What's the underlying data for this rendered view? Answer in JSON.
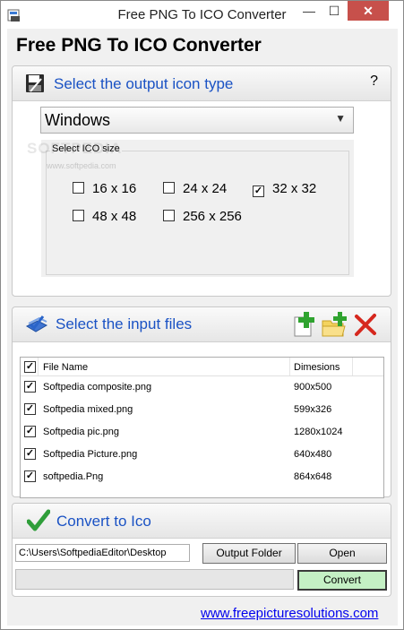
{
  "window": {
    "title": "Free PNG To ICO Converter",
    "minimize": "—",
    "maximize": "☐",
    "close": "✕"
  },
  "app": {
    "heading": "Free PNG To ICO Converter"
  },
  "output_panel": {
    "title": "Select the output icon type",
    "help": "?",
    "icon_type_selected": "Windows",
    "size_group_label": "Select ICO size",
    "sizes": [
      {
        "label": "16 x 16",
        "checked": false
      },
      {
        "label": "24 x 24",
        "checked": false
      },
      {
        "label": "32 x 32",
        "checked": true
      },
      {
        "label": "48 x 48",
        "checked": false
      },
      {
        "label": "256 x 256",
        "checked": false
      }
    ],
    "watermark": "SOFTPEDIA",
    "watermark_url": "www.softpedia.com"
  },
  "input_panel": {
    "title": "Select the input files",
    "icons": [
      "add-file-icon",
      "add-folder-icon",
      "remove-icon"
    ],
    "columns": {
      "name": "File Name",
      "dimensions": "Dimesions"
    },
    "files": [
      {
        "name": "Softpedia composite.png",
        "dimensions": "900x500",
        "checked": true
      },
      {
        "name": "Softpedia mixed.png",
        "dimensions": "599x326",
        "checked": true
      },
      {
        "name": "Softpedia pic.png",
        "dimensions": "1280x1024",
        "checked": true
      },
      {
        "name": "Softpedia Picture.png",
        "dimensions": "640x480",
        "checked": true
      },
      {
        "name": "softpedia.Png",
        "dimensions": "864x648",
        "checked": true
      }
    ]
  },
  "convert_panel": {
    "title": "Convert to Ico",
    "output_path": "C:\\Users\\SoftpediaEditor\\Desktop",
    "output_folder_label": "Output Folder",
    "open_label": "Open",
    "convert_label": "Convert",
    "progress": 0
  },
  "footer": {
    "link": "www.freepicturesolutions.com"
  },
  "colors": {
    "accent": "#1a52c4",
    "close": "#c7504b",
    "convert_button": "#c4f0c4",
    "link": "#0000ee"
  }
}
